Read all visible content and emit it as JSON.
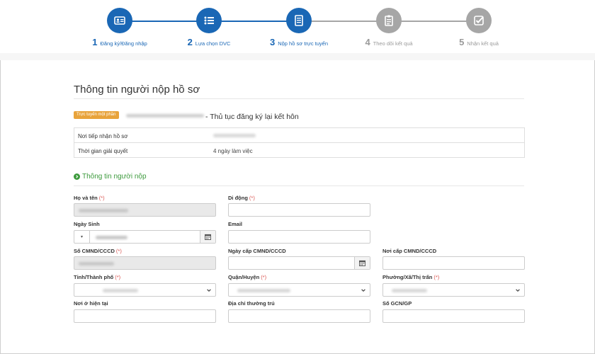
{
  "steps": [
    {
      "num": "1",
      "label": "Đăng ký/Đăng nhập",
      "icon": "id-card-icon",
      "state": "active"
    },
    {
      "num": "2",
      "label": "Lựa chọn DVC",
      "icon": "list-icon",
      "state": "active"
    },
    {
      "num": "3",
      "label": "Nộp hồ sơ trực tuyến",
      "icon": "document-icon",
      "state": "active"
    },
    {
      "num": "4",
      "label": "Theo dõi kết quả",
      "icon": "clipboard-icon",
      "state": "inactive"
    },
    {
      "num": "5",
      "label": "Nhận kết quả",
      "icon": "check-box-icon",
      "state": "inactive"
    }
  ],
  "colors": {
    "active": "#1a67b5",
    "inactive": "#a6a6a6",
    "badge": "#e8a33b",
    "sub_title": "#3c9a3c",
    "required": "#d9534f"
  },
  "page": {
    "section_title": "Thông tin người nộp hồ sơ",
    "badge": "Trực tuyến một phần",
    "procedure_title": "- Thủ tục đăng ký lại kết hôn"
  },
  "info": {
    "receive_label": "Nơi tiếp nhận hồ sơ",
    "time_label": "Thời gian giải quyết",
    "time_value": "4 ngày làm việc"
  },
  "form": {
    "sub_title": "Thông tin người nộp",
    "required_mark": "(*)",
    "fullname_label": "Họ và tên",
    "mobile_label": "Di động",
    "dob_label": "Ngày Sinh",
    "email_label": "Email",
    "id_label": "Số CMND/CCCD",
    "issue_date_label": "Ngày cấp CMND/CCCD",
    "issue_place_label": "Nơi cấp CMND/CCCD",
    "province_label": "Tỉnh/Thành phố",
    "district_label": "Quận/Huyện",
    "ward_label": "Phường/Xã/Thị trấn",
    "current_address_label": "Nơi ở hiện tại",
    "permanent_address_label": "Địa chỉ thường trú",
    "gcn_label": "Số GCN/GP"
  }
}
